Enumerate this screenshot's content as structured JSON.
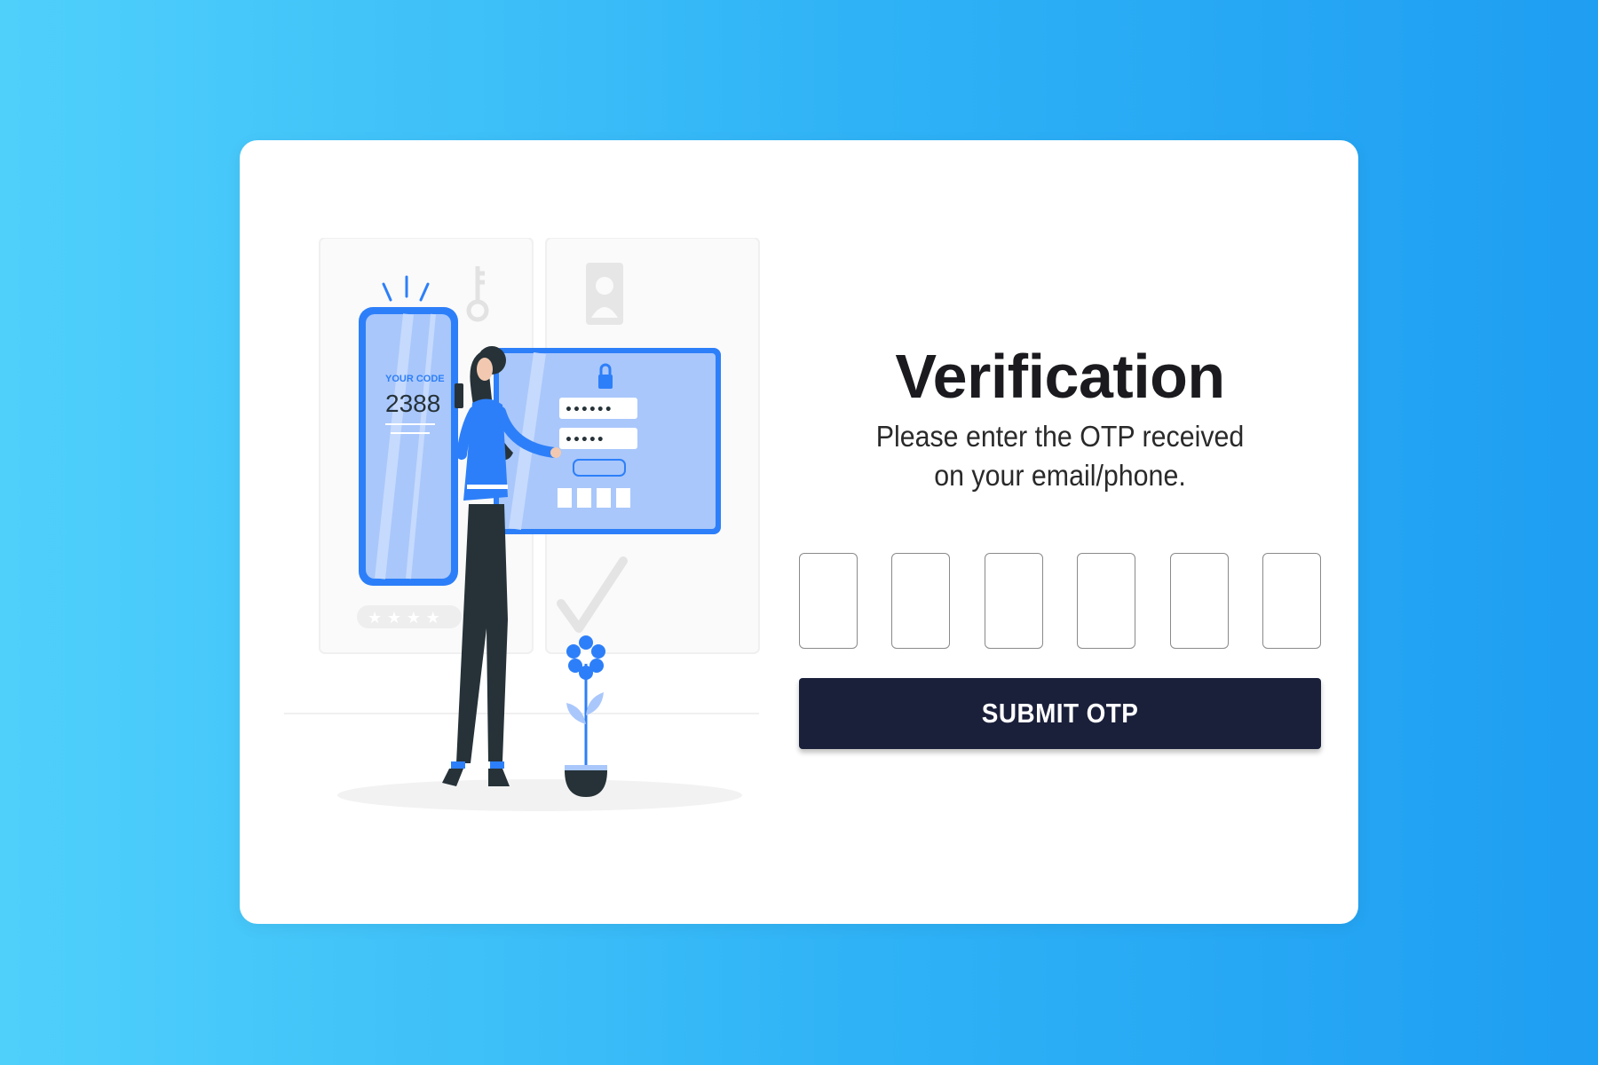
{
  "card": {
    "title": "Verification",
    "subtitle": "Please enter the OTP received on your email/phone.",
    "otp_fields": [
      "",
      "",
      "",
      "",
      "",
      ""
    ],
    "submit_label": "SUBMIT OTP"
  },
  "illustration": {
    "icon": "otp-verification-illustration",
    "phone_caption": "YOUR CODE",
    "phone_code": "2388",
    "accent_color": "#2d7ff9",
    "dark_color": "#263238"
  },
  "colors": {
    "background_start": "#4fd0fb",
    "background_end": "#1f9ef2",
    "button": "#1a1f3a"
  }
}
